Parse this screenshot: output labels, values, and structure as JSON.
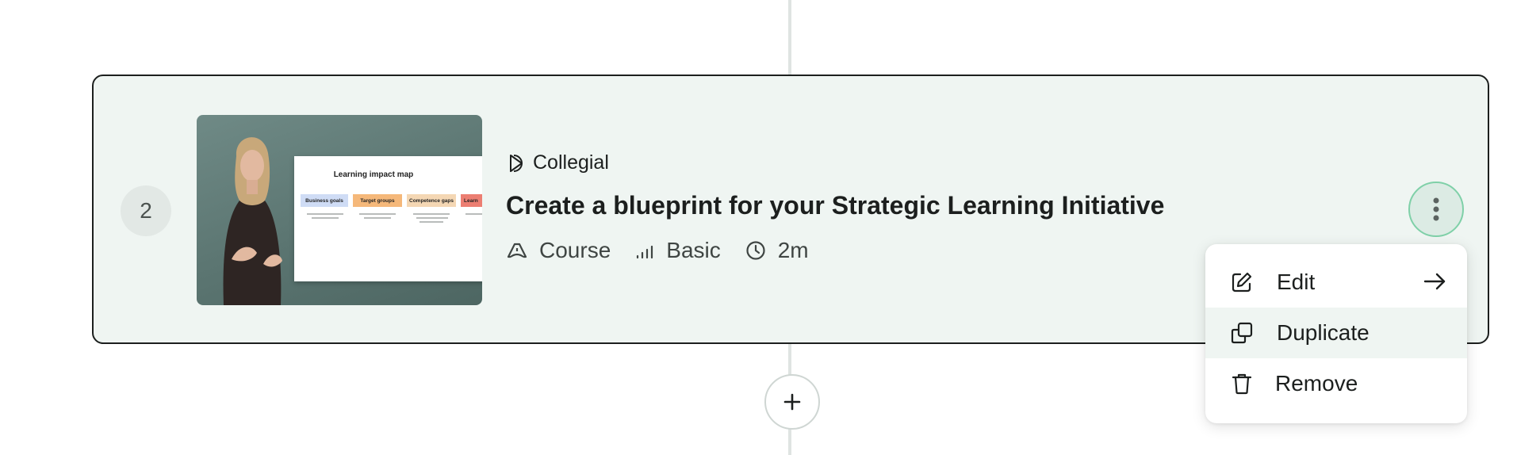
{
  "step": {
    "number": "2"
  },
  "thumbnail": {
    "slide_title": "Learning impact map",
    "columns": [
      {
        "label": "Business goals",
        "color": "#cfdcf5"
      },
      {
        "label": "Target groups",
        "color": "#f5b87a"
      },
      {
        "label": "Competence gaps",
        "color": "#f4d7b4"
      },
      {
        "label": "Learn",
        "color": "#ec7e72"
      }
    ]
  },
  "provider": {
    "name": "Collegial",
    "icon": "collegial-logo-icon"
  },
  "course": {
    "title": "Create a blueprint for your Strategic Learning Initiative",
    "type": "Course",
    "level": "Basic",
    "duration": "2m"
  },
  "menu": {
    "items": [
      {
        "label": "Edit",
        "icon": "pencil-icon"
      },
      {
        "label": "Duplicate",
        "icon": "duplicate-icon"
      },
      {
        "label": "Remove",
        "icon": "trash-icon"
      }
    ]
  },
  "colors": {
    "card_bg": "#eff5f2",
    "accent_border": "#7fd0a8",
    "text": "#1c1f1e"
  }
}
